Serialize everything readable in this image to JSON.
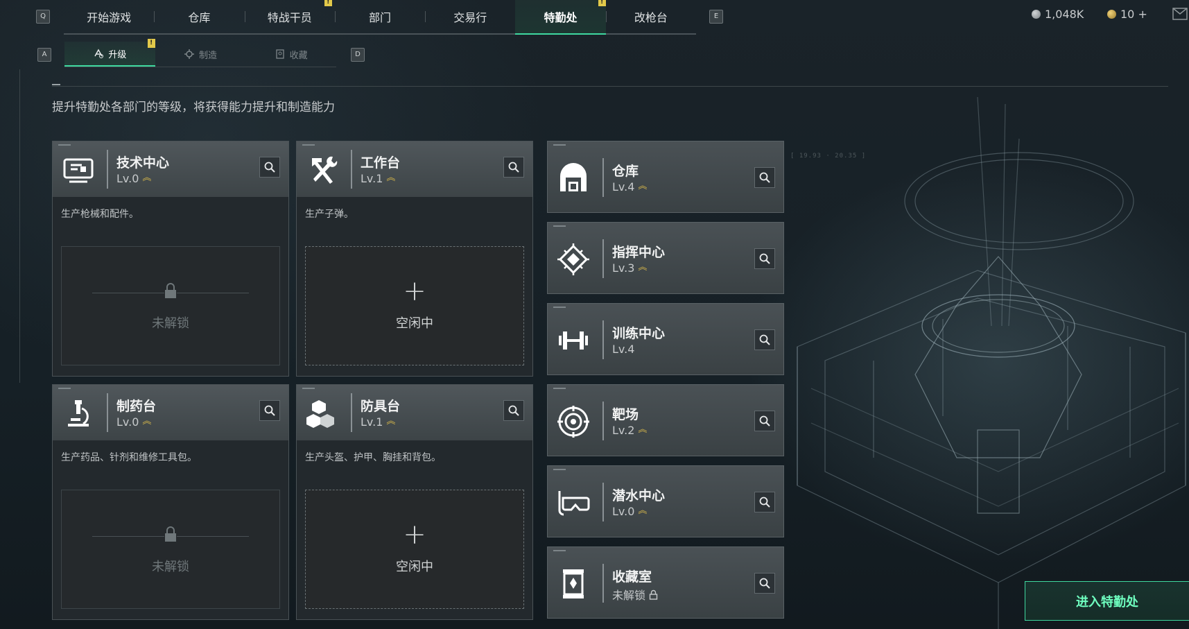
{
  "top_nav": {
    "left_key": "Q",
    "right_key": "E",
    "tabs": [
      {
        "label": "开始游戏"
      },
      {
        "label": "仓库"
      },
      {
        "label": "特战干员",
        "alert": "!"
      },
      {
        "label": "部门"
      },
      {
        "label": "交易行"
      },
      {
        "label": "特勤处",
        "alert": "!",
        "active": true
      },
      {
        "label": "改枪台"
      }
    ]
  },
  "currency": {
    "coins": "1,048K",
    "tickets": "10 +"
  },
  "sub_nav": {
    "left_key": "A",
    "right_key": "D",
    "tabs": [
      {
        "label": "升级",
        "alert": "!",
        "active": true
      },
      {
        "label": "制造"
      },
      {
        "label": "收藏"
      }
    ]
  },
  "description": "提升特勤处各部门的等级，将获得能力提升和制造能力",
  "departments": [
    {
      "name": "技术中心",
      "level": "Lv.0",
      "icon": "monitor-icon",
      "desc": "生产枪械和配件。",
      "slot": "未解锁"
    },
    {
      "name": "工作台",
      "level": "Lv.1",
      "icon": "hammer-wrench-icon",
      "desc": "生产子弹。",
      "slot": "空闲中"
    },
    {
      "name": "制药台",
      "level": "Lv.0",
      "icon": "microscope-icon",
      "desc": "生产药品、针剂和维修工具包。",
      "slot": "未解锁"
    },
    {
      "name": "防具台",
      "level": "Lv.1",
      "icon": "cubes-icon",
      "desc": "生产头盔、护甲、胸挂和背包。",
      "slot": "空闲中"
    }
  ],
  "facilities": [
    {
      "name": "仓库",
      "level": "Lv.4",
      "icon": "warehouse-icon"
    },
    {
      "name": "指挥中心",
      "level": "Lv.3",
      "icon": "chip-icon"
    },
    {
      "name": "训练中心",
      "level": "Lv.4",
      "icon": "dumbbell-icon"
    },
    {
      "name": "靶场",
      "level": "Lv.2",
      "icon": "target-icon"
    },
    {
      "name": "潜水中心",
      "level": "Lv.0",
      "icon": "diving-mask-icon"
    },
    {
      "name": "收藏室",
      "level": "未解锁",
      "icon": "display-case-icon"
    }
  ],
  "enter_button": "进入特勤处",
  "colors": {
    "accent": "#3fd9a0",
    "alert": "#e2c94a",
    "upgrade": "#d8b84a"
  }
}
